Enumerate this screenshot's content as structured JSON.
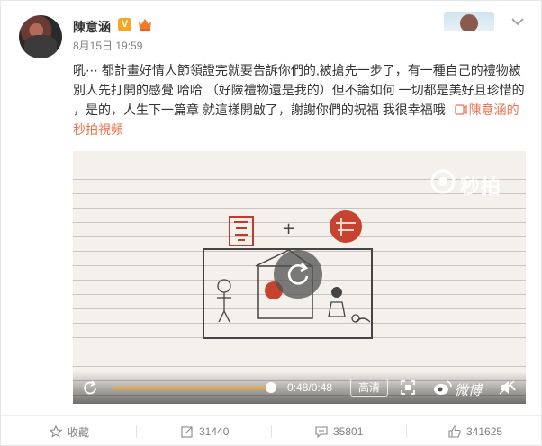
{
  "post": {
    "author": "陳意涵",
    "verified_badge": "V",
    "date": "8月15日 19:59",
    "text": "吼⋯ 都計畫好情人節領證完就要告訴你們的,被搶先一步了，有一種自己的禮物被別人先打開的感覺 哈哈 （好險禮物還是我的）但不論如何 一切都是美好且珍惜的 ，是的，人生下一篇章 就這樣開啟了，謝謝你們的祝福 我很幸福哦",
    "link_text": "陳意涵的秒拍視頻",
    "link_icon": "video-link-icon"
  },
  "video": {
    "watermark": "秒拍",
    "time": "0:48/0:48",
    "quality": "高清",
    "brand": "微博",
    "progress": 1.0
  },
  "footer": {
    "favorite": "收藏",
    "repost": "31440",
    "comment": "35801",
    "like": "341625"
  },
  "colors": {
    "accent": "#eb7350",
    "progress": "#f5a623",
    "badge": "#f5a623"
  }
}
